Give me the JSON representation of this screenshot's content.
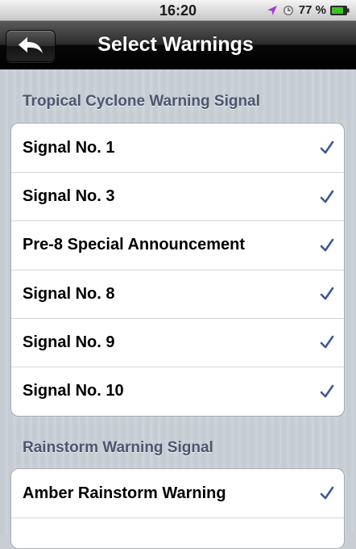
{
  "status_bar": {
    "time": "16:20",
    "battery_percent": "77 %",
    "icons": [
      "location-arrow-icon",
      "clock-icon",
      "battery-icon"
    ],
    "location_color": "#a03cd2",
    "battery_color": "#3fc12a"
  },
  "nav": {
    "title": "Select Warnings",
    "back_icon": "back-arrow-icon"
  },
  "sections": [
    {
      "header": "Tropical Cyclone Warning Signal",
      "items": [
        {
          "label": "Signal No. 1",
          "checked": true
        },
        {
          "label": "Signal No. 3",
          "checked": true
        },
        {
          "label": "Pre-8 Special Announcement",
          "checked": true
        },
        {
          "label": "Signal No. 8",
          "checked": true
        },
        {
          "label": "Signal No. 9",
          "checked": true
        },
        {
          "label": "Signal No. 10",
          "checked": true
        }
      ]
    },
    {
      "header": "Rainstorm Warning Signal",
      "items": [
        {
          "label": "Amber Rainstorm Warning",
          "checked": true
        }
      ]
    }
  ],
  "colors": {
    "checkmark": "#3a5a92",
    "section_header": "#4c566c"
  }
}
